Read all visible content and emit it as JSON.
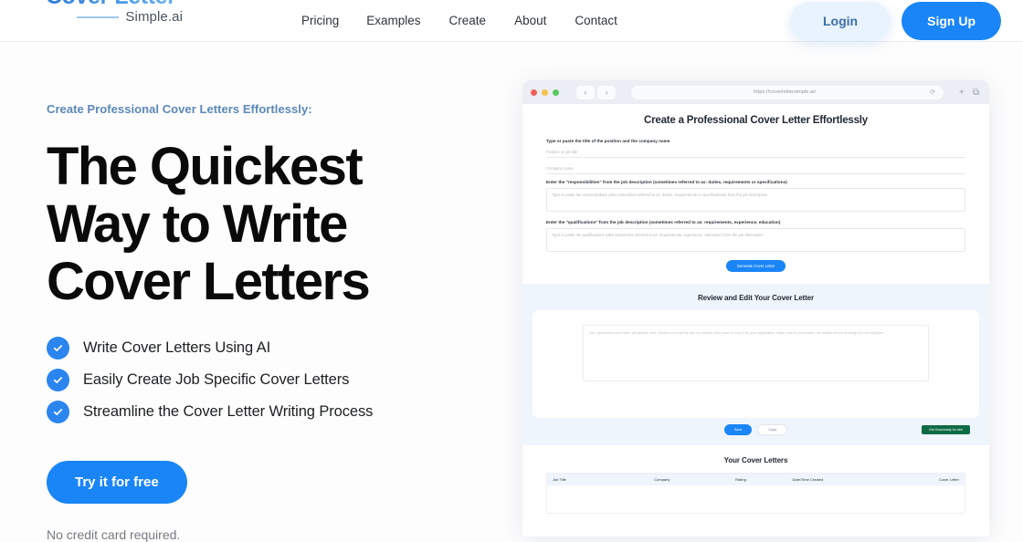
{
  "header": {
    "logo": {
      "main": "Cover Letter",
      "sub": "Simple.ai"
    },
    "nav": [
      {
        "label": "Pricing"
      },
      {
        "label": "Examples"
      },
      {
        "label": "Create"
      },
      {
        "label": "About"
      },
      {
        "label": "Contact"
      }
    ],
    "login_label": "Login",
    "signup_label": "Sign Up",
    "accent_color": "#1a85f7",
    "login_bg": "#e9f3fd"
  },
  "hero": {
    "eyebrow": "Create Professional Cover Letters Effortlessly:",
    "headline_lines": [
      "The Quickest",
      "Way to Write",
      "Cover Letters"
    ],
    "headline_full": "The Quickest Way to Write Cover Letters",
    "features": [
      {
        "label": "Write Cover Letters Using AI"
      },
      {
        "label": "Easily Create Job Specific Cover Letters"
      },
      {
        "label": "Streamline the Cover Letter Writing Process"
      }
    ],
    "cta_label": "Try it for free",
    "note": "No credit card required."
  },
  "browser": {
    "url": "https://coverlettersimple.ai/",
    "traffic_lights": [
      "close-red",
      "minimize-yellow",
      "maximize-green"
    ],
    "back_glyph": "‹",
    "forward_glyph": "›",
    "reload_glyph": "⟳",
    "new_tab_glyph": "+",
    "tabs_glyph": "⧉"
  },
  "mockup": {
    "card1": {
      "heading": "Create a Professional Cover Letter Effortlessly",
      "label_title": "Type or paste the title of the position and the company name",
      "input_position": "Position or job title",
      "input_company": "Company name",
      "label_responsibilities": "Enter the \"responsibilities\" from the job description (sometimes referred to as: duties, requirements or specifications)",
      "area_responsibilities": "Type or paste the responsibilities (also sometimes referred to as: duties, requirements or specifications) from the job description",
      "label_qualifications": "Enter the \"qualifications\" from the job description (sometimes referred to as: requirements, experience, education)",
      "area_qualifications": "Type or paste the qualifications (also sometimes referred to as: requirements, experience, education) from the job description",
      "generate_label": "Generate Cover Letter"
    },
    "card2": {
      "heading": "Review and Edit Your Cover Letter",
      "letter_text": "Your generated cover letter will appear here. Review and edit the text as needed, then save or copy it for your application. Make sure to personalize the details before sending it to the employer.",
      "save_label": "Save",
      "copy_label": "Copy",
      "grammarly_label": "Get Grammarly for free"
    },
    "card3": {
      "heading": "Your Cover Letters",
      "columns": [
        "Job Title",
        "Company",
        "Rating",
        "Date/Time Created",
        "Cover Letter"
      ]
    }
  }
}
